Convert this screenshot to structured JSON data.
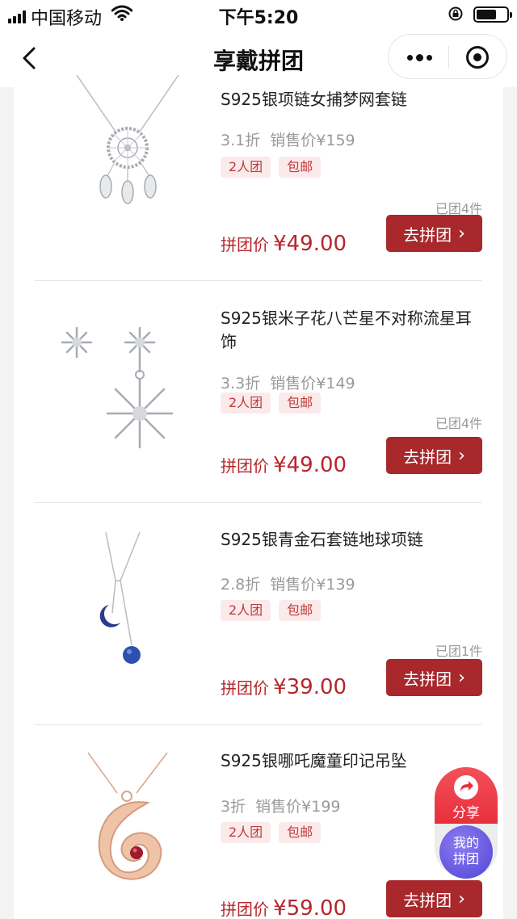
{
  "status_bar": {
    "carrier": "中国移动",
    "time": "下午5:20"
  },
  "nav": {
    "title": "享戴拼团"
  },
  "products": [
    {
      "name": "S925银项链女捕梦网套链",
      "discount": "3.1折",
      "retail_label": "销售价",
      "retail_price": "¥159",
      "tags": [
        "2人团",
        "包邮"
      ],
      "sold": "已团4件",
      "group_price_label": "拼团价",
      "group_price": "¥49.00",
      "button_label": "去拼团"
    },
    {
      "name": "S925银米子花八芒星不对称流星耳饰",
      "discount": "3.3折",
      "retail_label": "销售价",
      "retail_price": "¥149",
      "tags": [
        "2人团",
        "包邮"
      ],
      "sold": "已团4件",
      "group_price_label": "拼团价",
      "group_price": "¥49.00",
      "button_label": "去拼团"
    },
    {
      "name": "S925银青金石套链地球项链",
      "discount": "2.8折",
      "retail_label": "销售价",
      "retail_price": "¥139",
      "tags": [
        "2人团",
        "包邮"
      ],
      "sold": "已团1件",
      "group_price_label": "拼团价",
      "group_price": "¥39.00",
      "button_label": "去拼团"
    },
    {
      "name": "S925银哪吒魔童印记吊坠",
      "discount": "3折",
      "retail_label": "销售价",
      "retail_price": "¥199",
      "tags": [
        "2人团",
        "包邮"
      ],
      "sold": "",
      "group_price_label": "拼团价",
      "group_price": "¥59.00",
      "button_label": "去拼团"
    }
  ],
  "fab": {
    "share_label": "分享",
    "mine_line1": "我的",
    "mine_line2": "拼团"
  },
  "colors": {
    "accent": "#a8282c",
    "price_red": "#b5262b",
    "tag_bg": "#fbeaea",
    "fab_share": "#e8303c",
    "fab_mine": "#4d45d6"
  }
}
